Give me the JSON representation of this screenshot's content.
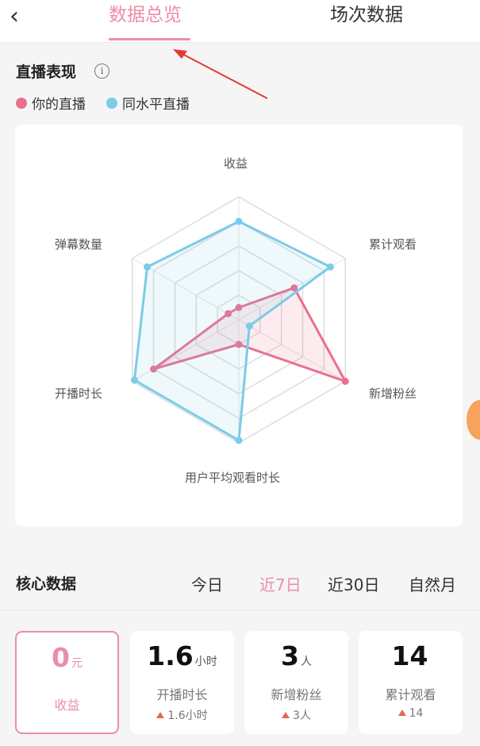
{
  "header": {
    "back_icon": "chevron-left-icon",
    "tabs": [
      {
        "label": "数据总览",
        "active": true
      },
      {
        "label": "场次数据",
        "active": false
      }
    ]
  },
  "live_performance": {
    "title": "直播表现",
    "info_icon": "info-icon",
    "legend": [
      {
        "label": "你的直播",
        "color": "#ea6f8d"
      },
      {
        "label": "同水平直播",
        "color": "#7ccbe8"
      }
    ]
  },
  "chart_data": {
    "type": "radar",
    "axes": [
      "收益",
      "累计观看",
      "新增粉丝",
      "用户平均观看时长",
      "开播时长",
      "弹幕数量"
    ],
    "max": 5,
    "rings": 5,
    "series": [
      {
        "name": "你的直播",
        "color": "#ea6f8d",
        "values": [
          0.5,
          2.6,
          5.0,
          1.0,
          4.0,
          0.5
        ]
      },
      {
        "name": "同水平直播",
        "color": "#7ccbe8",
        "values": [
          4.0,
          4.3,
          0.5,
          4.9,
          4.9,
          4.3
        ]
      }
    ]
  },
  "core": {
    "title": "核心数据",
    "periods": [
      {
        "label": "今日",
        "active": false
      },
      {
        "label": "近7日",
        "active": true
      },
      {
        "label": "近30日",
        "active": false
      },
      {
        "label": "自然月",
        "active": false
      }
    ],
    "cards": [
      {
        "value": "0",
        "unit": "元",
        "label": "收益",
        "delta": "",
        "selected": true
      },
      {
        "value": "1.6",
        "unit": "小时",
        "label": "开播时长",
        "delta": "1.6小时",
        "selected": false
      },
      {
        "value": "3",
        "unit": "人",
        "label": "新增粉丝",
        "delta": "3人",
        "selected": false
      },
      {
        "value": "14",
        "unit": "",
        "label": "累计观看",
        "delta": "14",
        "selected": false
      }
    ]
  }
}
